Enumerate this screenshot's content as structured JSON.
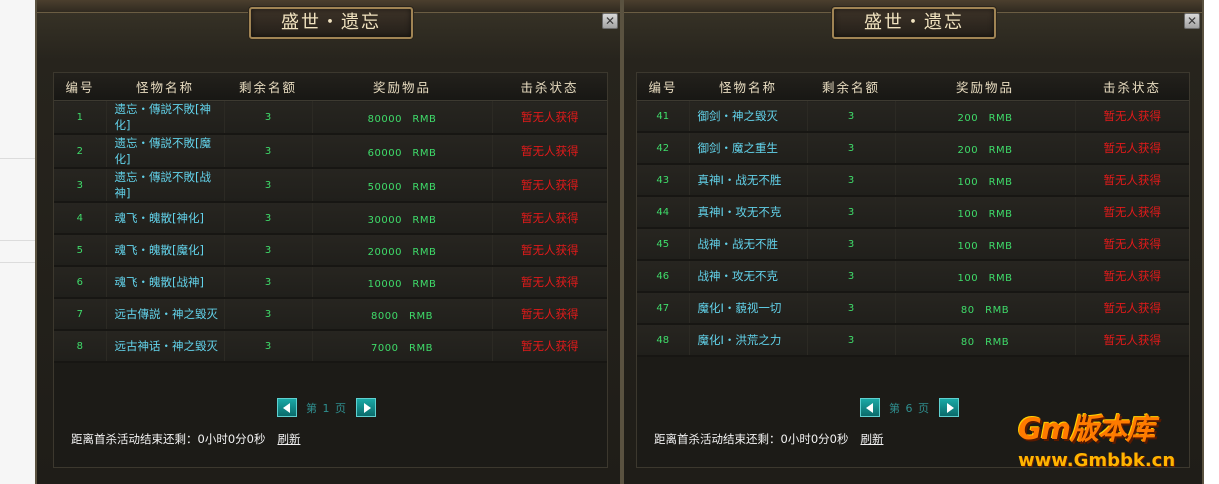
{
  "panels": [
    {
      "title": "盛世・遗忘",
      "close_glyph": "✕",
      "headers": [
        "编号",
        "怪物名称",
        "剩余名额",
        "奖励物品",
        "击杀状态"
      ],
      "rows": [
        {
          "no": "1",
          "name": "遗忘・傳説不敗[神化]",
          "count": "3",
          "reward": "80000　RMB",
          "status": "暂无人获得"
        },
        {
          "no": "2",
          "name": "遗忘・傳説不敗[魔化]",
          "count": "3",
          "reward": "60000　RMB",
          "status": "暂无人获得"
        },
        {
          "no": "3",
          "name": "遗忘・傳説不敗[战神]",
          "count": "3",
          "reward": "50000　RMB",
          "status": "暂无人获得"
        },
        {
          "no": "4",
          "name": "魂飞・魄散[神化]",
          "count": "3",
          "reward": "30000　RMB",
          "status": "暂无人获得"
        },
        {
          "no": "5",
          "name": "魂飞・魄散[魔化]",
          "count": "3",
          "reward": "20000　RMB",
          "status": "暂无人获得"
        },
        {
          "no": "6",
          "name": "魂飞・魄散[战神]",
          "count": "3",
          "reward": "10000　RMB",
          "status": "暂无人获得"
        },
        {
          "no": "7",
          "name": "远古傳説・神之毀灭",
          "count": "3",
          "reward": "8000　RMB",
          "status": "暂无人获得"
        },
        {
          "no": "8",
          "name": "远古神话・神之毀灭",
          "count": "3",
          "reward": "7000　RMB",
          "status": "暂无人获得"
        }
      ],
      "page_text": "第 1 页",
      "footer_text": "距离首杀活动结束还剩：0小时0分0秒",
      "refresh_label": "刷新"
    },
    {
      "title": "盛世・遗忘",
      "close_glyph": "✕",
      "headers": [
        "编号",
        "怪物名称",
        "剩余名额",
        "奖励物品",
        "击杀状态"
      ],
      "rows": [
        {
          "no": "41",
          "name": "御剑・神之毀灭",
          "count": "3",
          "reward": "200　RMB",
          "status": "暂无人获得"
        },
        {
          "no": "42",
          "name": "御剑・魔之重生",
          "count": "3",
          "reward": "200　RMB",
          "status": "暂无人获得"
        },
        {
          "no": "43",
          "name": "真神Ⅰ・战无不胜",
          "count": "3",
          "reward": "100　RMB",
          "status": "暂无人获得"
        },
        {
          "no": "44",
          "name": "真神Ⅰ・攻无不克",
          "count": "3",
          "reward": "100　RMB",
          "status": "暂无人获得"
        },
        {
          "no": "45",
          "name": "战神・战无不胜",
          "count": "3",
          "reward": "100　RMB",
          "status": "暂无人获得"
        },
        {
          "no": "46",
          "name": "战神・攻无不克",
          "count": "3",
          "reward": "100　RMB",
          "status": "暂无人获得"
        },
        {
          "no": "47",
          "name": "魔化Ⅰ・藐视一切",
          "count": "3",
          "reward": "80　RMB",
          "status": "暂无人获得"
        },
        {
          "no": "48",
          "name": "魔化Ⅰ・洪荒之力",
          "count": "3",
          "reward": "80　RMB",
          "status": "暂无人获得"
        }
      ],
      "page_text": "第 6 页",
      "footer_text": "距离首杀活动结束还剩：0小时0分0秒",
      "refresh_label": "刷新"
    }
  ],
  "watermark": {
    "logo_text": "Gm版本库",
    "url": "www.Gmbbk.cn"
  },
  "colors": {
    "name_cyan": "#62d2ea",
    "value_green": "#3fdc6a",
    "status_red": "#e21a1a",
    "title_gold": "#f0e2bf"
  }
}
